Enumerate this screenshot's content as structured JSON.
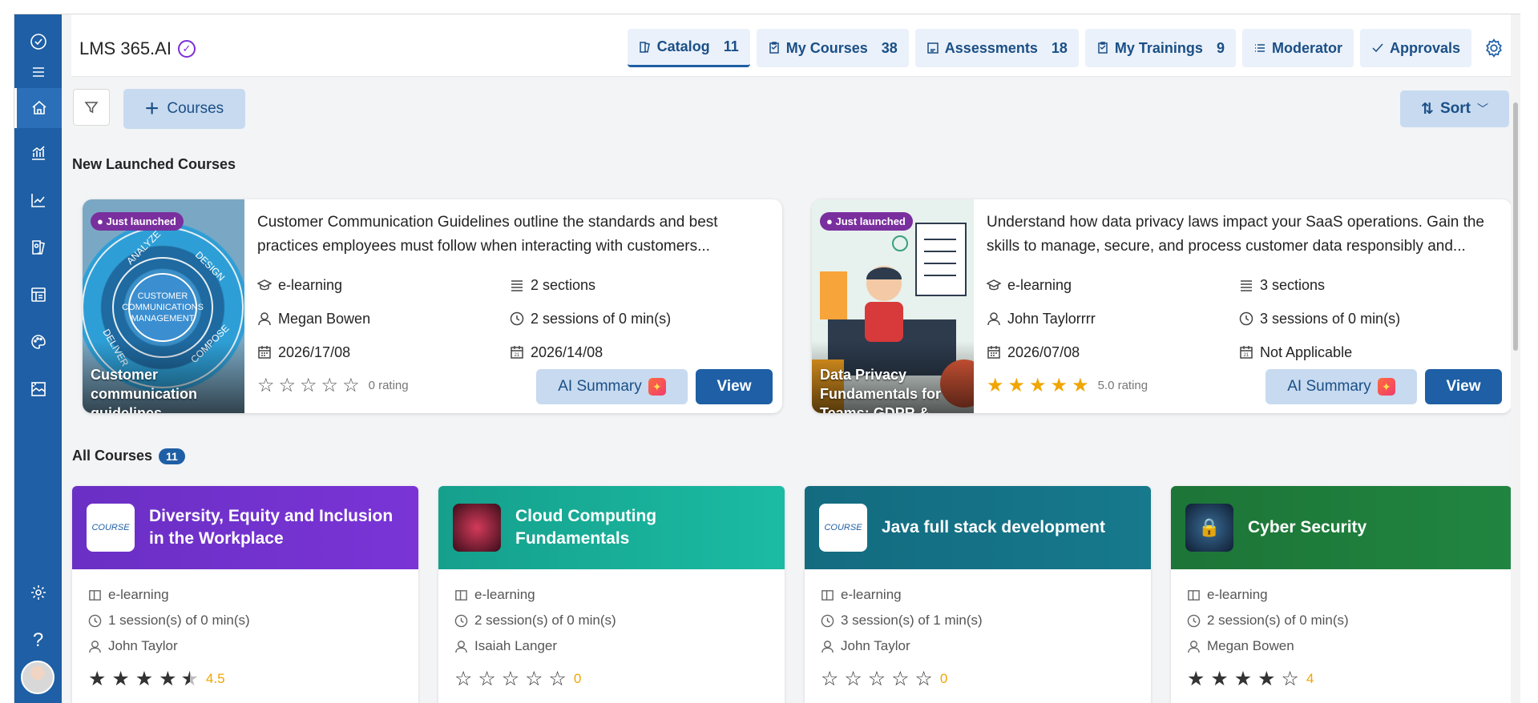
{
  "app": {
    "title": "LMS 365.AI"
  },
  "nav": [
    {
      "label": "Catalog",
      "count": "11",
      "icon": "catalog-icon"
    },
    {
      "label": "My Courses",
      "count": "38",
      "icon": "clipboard-icon"
    },
    {
      "label": "Assessments",
      "count": "18",
      "icon": "assessment-icon"
    },
    {
      "label": "My Trainings",
      "count": "9",
      "icon": "clipboard-icon"
    },
    {
      "label": "Moderator",
      "count": "",
      "icon": "list-icon"
    },
    {
      "label": "Approvals",
      "count": "",
      "icon": "check-icon"
    }
  ],
  "toolbar": {
    "add_label": "Courses",
    "sort_label": "Sort"
  },
  "new_section": {
    "title": "New Launched Courses"
  },
  "new_courses": [
    {
      "tag": "Just launched",
      "caption": "Customer communication guidelines",
      "description": "Customer Communication Guidelines outline the standards and best practices employees must follow when interacting with customers...",
      "type": "e-learning",
      "sections": "2 sections",
      "author": "Megan Bowen",
      "sessions": "2 sessions of 0 min(s)",
      "start_date": "2026/17/08",
      "end_date": "2026/14/08",
      "rating": 0,
      "rating_text": "0 rating",
      "ai_label": "AI Summary",
      "view_label": "View"
    },
    {
      "tag": "Just launched",
      "caption": "Data Privacy Fundamentals for Teams: GDPR &",
      "description": "Understand how data privacy laws impact your SaaS operations. Gain the skills to manage, secure, and process customer data responsibly and...",
      "type": "e-learning",
      "sections": "3 sections",
      "author": "John Taylorrrr",
      "sessions": "3 sessions of 0 min(s)",
      "start_date": "2026/07/08",
      "end_date": "Not Applicable",
      "rating": 5,
      "rating_text": "5.0 rating",
      "ai_label": "AI Summary",
      "view_label": "View"
    }
  ],
  "all_section": {
    "title": "All Courses",
    "count": "11"
  },
  "courses": [
    {
      "title": "Diversity, Equity and Inclusion in the Workplace",
      "color": "#6a2fc4",
      "type": "e-learning",
      "sessions": "1 session(s) of 0 min(s)",
      "author": "John Taylor",
      "rating": 4.5,
      "rating_text": "4.5"
    },
    {
      "title": "Cloud Computing Fundamentals",
      "color": "#19b29b",
      "type": "e-learning",
      "sessions": "2 session(s) of 0 min(s)",
      "author": "Isaiah Langer",
      "rating": 0,
      "rating_text": "0"
    },
    {
      "title": "Java full stack development",
      "color": "#136b80",
      "type": "e-learning",
      "sessions": "3 session(s) of 1 min(s)",
      "author": "John Taylor",
      "rating": 0,
      "rating_text": "0"
    },
    {
      "title": "Cyber Security",
      "color": "#1f7c3a",
      "type": "e-learning",
      "sessions": "2 session(s) of 0 min(s)",
      "author": "Megan Bowen",
      "rating": 4,
      "rating_text": "4"
    }
  ]
}
